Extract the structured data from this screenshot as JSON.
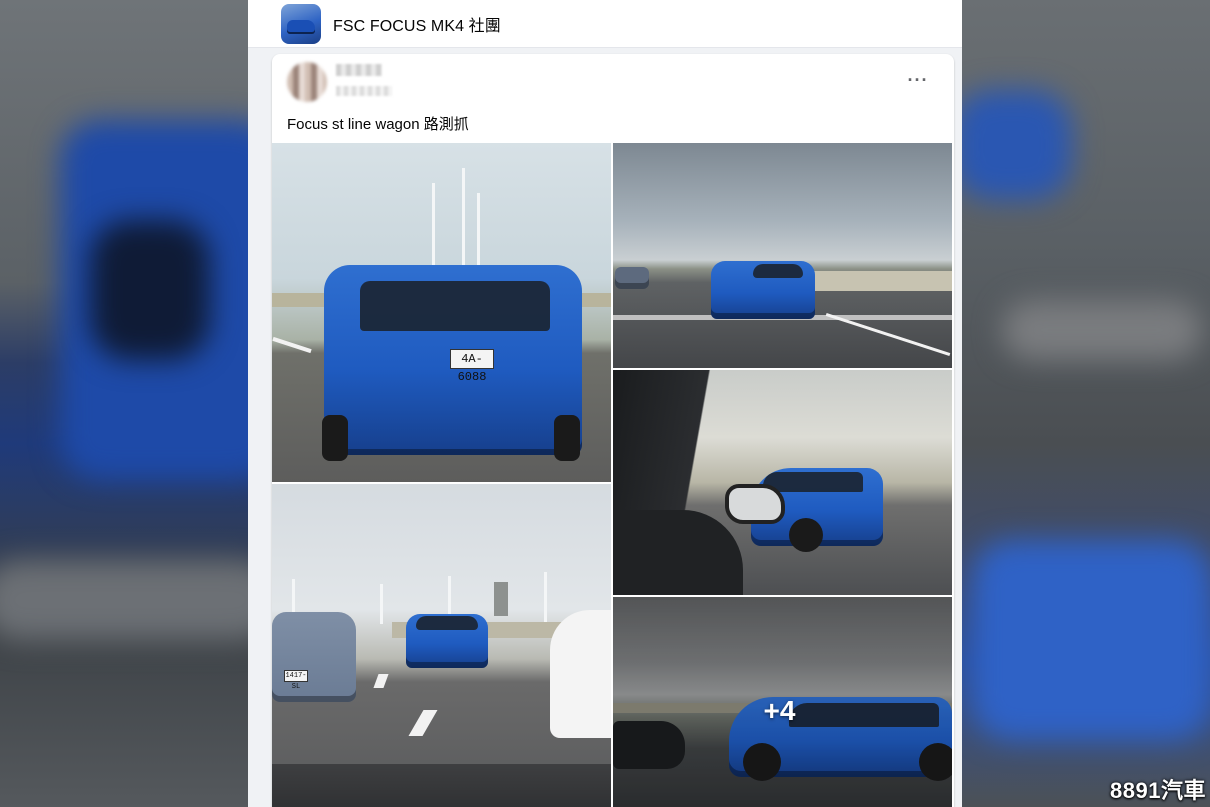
{
  "group": {
    "name": "FSC FOCUS MK4 社團"
  },
  "post": {
    "text": "Focus st line wagon 路測抓",
    "more_icon": "more-horizontal-icon",
    "more_label": "···"
  },
  "photos": {
    "photo1": {
      "plate": "4A-6088"
    },
    "photo4": {
      "plate": "1417-SL"
    },
    "more_overlay": "+4"
  },
  "watermark": "8891汽車",
  "colors": {
    "facebook_bg": "#f0f2f5",
    "car_blue": "#1f5bc0",
    "text": "#050505"
  }
}
